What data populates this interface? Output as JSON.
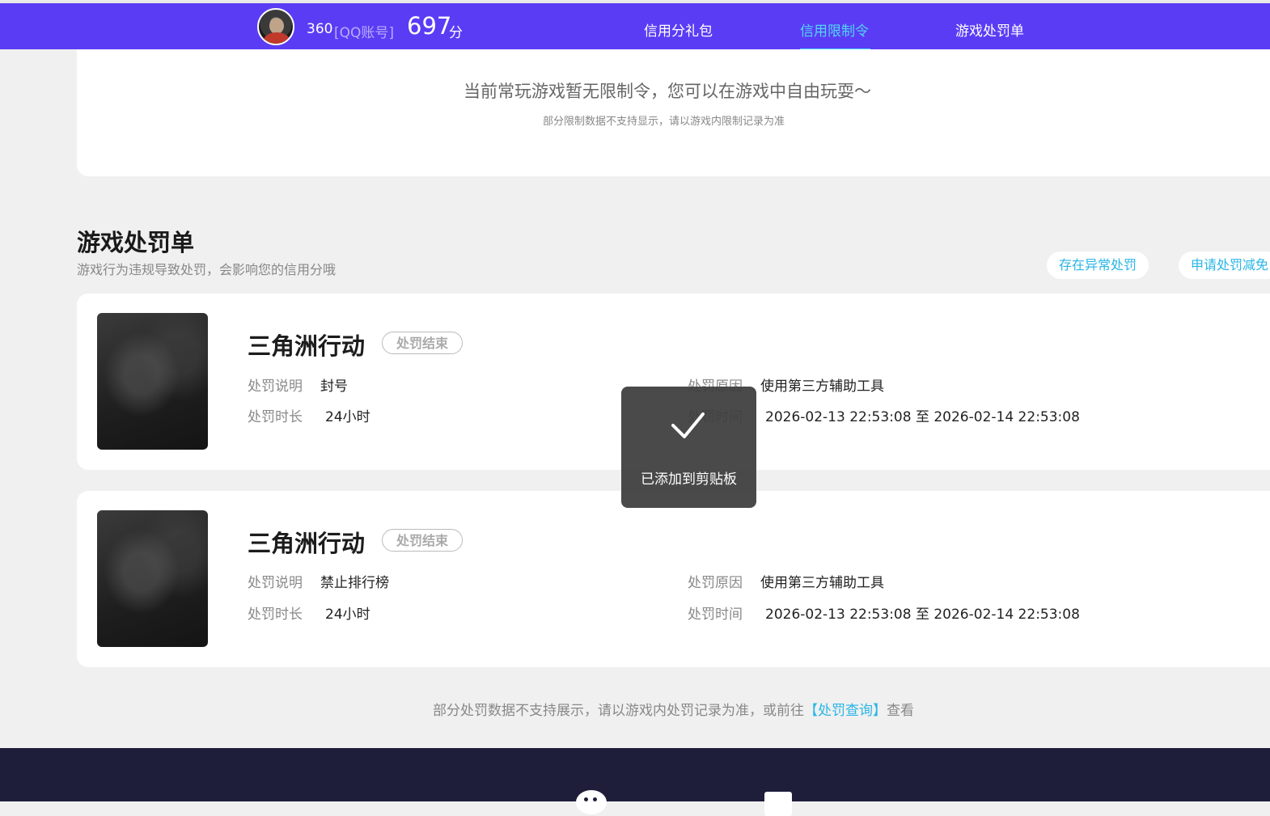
{
  "header": {
    "account_number": "360",
    "account_type": "[QQ账号]",
    "score": "697",
    "score_unit": "分",
    "nav": [
      {
        "label": "信用分礼包",
        "active": false
      },
      {
        "label": "信用限制令",
        "active": true
      },
      {
        "label": "游戏处罚单",
        "active": false
      }
    ]
  },
  "limit": {
    "message": "当前常玩游戏暂无限制令，您可以在游戏中自由玩耍～",
    "note": "部分限制数据不支持显示，请以游戏内限制记录为准"
  },
  "penalty_section": {
    "title": "游戏处罚单",
    "subtitle": "游戏行为违规导致处罚，会影响您的信用分哦",
    "buttons": [
      "存在异常处罚",
      "申请处罚减免"
    ],
    "labels": {
      "desc": "处罚说明",
      "duration": "处罚时长",
      "reason": "处罚原因",
      "time": "处罚时间"
    },
    "records": [
      {
        "game": "三角洲行动",
        "status": "处罚结束",
        "desc": "封号",
        "duration": "24小时",
        "reason": "使用第三方辅助工具",
        "time": "2026-02-13 22:53:08 至 2026-02-14 22:53:08"
      },
      {
        "game": "三角洲行动",
        "status": "处罚结束",
        "desc": "禁止排行榜",
        "duration": "24小时",
        "reason": "使用第三方辅助工具",
        "time": "2026-02-13 22:53:08 至 2026-02-14 22:53:08"
      }
    ]
  },
  "footer_note": {
    "prefix": "部分处罚数据不支持展示，请以游戏内处罚记录为准，或前往",
    "link": "【处罚查询】",
    "suffix": "查看"
  },
  "toast": {
    "message": "已添加到剪贴板",
    "icon": "checkmark-icon"
  },
  "colors": {
    "header_bg": "#5b3cf5",
    "accent": "#4fd7f5",
    "link": "#29b6e6",
    "footer_bg": "#1e1d3a"
  }
}
